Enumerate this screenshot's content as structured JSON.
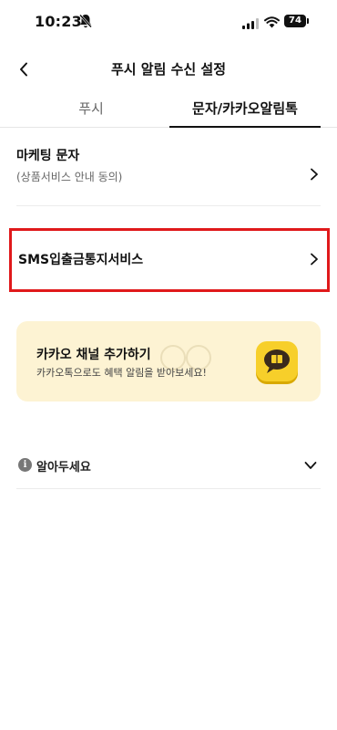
{
  "status_bar": {
    "time": "10:23",
    "battery": "74"
  },
  "header": {
    "title": "푸시 알림 수신 설정"
  },
  "tabs": [
    {
      "label": "푸시",
      "selected": false
    },
    {
      "label": "문자/카카오알림톡",
      "selected": true
    }
  ],
  "rows": {
    "marketing": {
      "title": "마케팅 문자",
      "subtitle": "(상품서비스 안내 동의)"
    },
    "sms": {
      "title": "SMS입출금통지서비스"
    }
  },
  "kakao_banner": {
    "title": "카카오 채널 추가하기",
    "subtitle": "카카오톡으로도 혜택 알림을 받아보세요!"
  },
  "notice": {
    "label": "알아두세요"
  },
  "colors": {
    "highlight": "#e0191b",
    "banner_bg": "#fdf3d3",
    "kakao_yellow": "#f7cf2a"
  }
}
